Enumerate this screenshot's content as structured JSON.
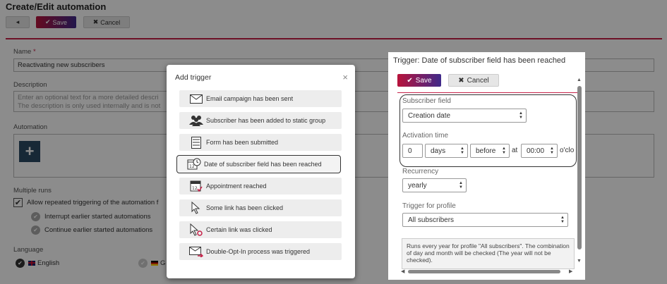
{
  "page": {
    "title": "Create/Edit automation",
    "toolbar": {
      "back_icon": "◂",
      "save_label": "Save",
      "cancel_label": "Cancel"
    },
    "name_label": "Name",
    "name_required": "*",
    "name_value": "Reactivating new subscribers",
    "description_label": "Description",
    "description_placeholder_1": "Enter an optional text for a more detailed descri",
    "description_placeholder_2": "The description is only used internally and is not",
    "automation_label": "Automation",
    "add_symbol": "+",
    "multiple_runs_label": "Multiple runs",
    "allow_repeated": "Allow repeated triggering of the automation f",
    "interrupt_label": "Interrupt earlier started automations",
    "continue_label": "Continue earlier started automations",
    "language_label": "Language",
    "lang_english": "English",
    "lang_german_partial": "G"
  },
  "modal": {
    "title": "Add trigger",
    "close": "×",
    "triggers": [
      {
        "label": "Email campaign has been sent",
        "icon": "envelope-icon"
      },
      {
        "label": "Subscriber has been added to static group",
        "icon": "users-icon"
      },
      {
        "label": "Form has been submitted",
        "icon": "form-icon"
      },
      {
        "label": "Date of subscriber field has been reached",
        "icon": "calendar-clock-icon"
      },
      {
        "label": "Appointment reached",
        "icon": "calendar-check-icon"
      },
      {
        "label": "Some link has been clicked",
        "icon": "cursor-icon"
      },
      {
        "label": "Certain link was clicked",
        "icon": "cursor-target-icon"
      },
      {
        "label": "Double-Opt-In process was triggered",
        "icon": "envelope-arrow-icon"
      }
    ],
    "selected_index": 3
  },
  "panel": {
    "title": "Trigger: Date of subscriber field has been reached",
    "save_label": "Save",
    "cancel_label": "Cancel",
    "subscriber_field_label": "Subscriber field",
    "subscriber_field_value": "Creation date",
    "activation_time_label": "Activation time",
    "activation_amount": "0",
    "activation_unit": "days",
    "activation_direction": "before",
    "at_label": "at",
    "activation_time": "00:00",
    "oclock_partial": "o'clo",
    "recurrency_label": "Recurrency",
    "recurrency_value": "yearly",
    "trigger_for_profile_label": "Trigger for profile",
    "trigger_for_profile_value": "All subscribers",
    "info_text": "Runs every year for profile \"All subscribers\". The combination of day and month will be checked (The year will not be checked)."
  },
  "colors": {
    "accent_red": "#c62048",
    "save_gradient_start": "#b8133b",
    "save_gradient_end": "#3f2a8a",
    "overlay": "rgba(0,0,0,0.45)"
  }
}
